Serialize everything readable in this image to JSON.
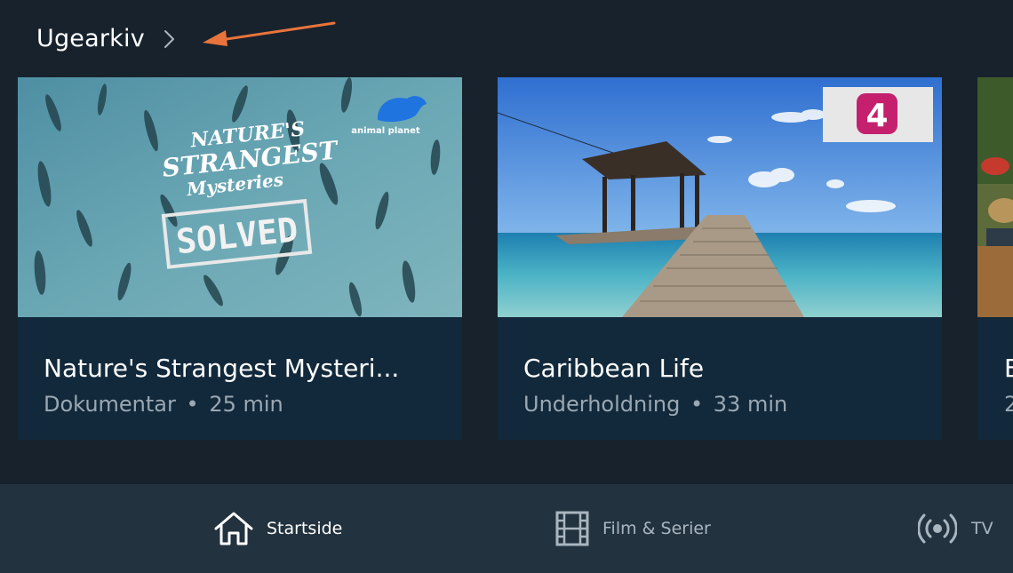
{
  "section": {
    "title": "Ugearkiv"
  },
  "cards": [
    {
      "title": "Nature's Strangest Mysteri...",
      "genre": "Dokumentar",
      "separator": "•",
      "duration": "25 min",
      "art_text": [
        "NATURE'S",
        "STRANGEST",
        "Mysteries",
        "SOLVED"
      ],
      "channel_logo": "animal planet"
    },
    {
      "title": "Caribbean Life",
      "genre": "Underholdning",
      "separator": "•",
      "duration": "33 min",
      "channel_logo": "4"
    },
    {
      "title": "E",
      "meta": "2"
    }
  ],
  "nav": {
    "home_label": "Startside",
    "film_label": "Film & Serier",
    "tv_label": "TV",
    "icons": [
      "home-icon",
      "film-icon",
      "broadcast-icon"
    ]
  },
  "colors": {
    "background": "#17222d",
    "card": "#12293b",
    "nav_bar": "#22323f",
    "annotation_arrow": "#e8743b",
    "meta_text": "#9aa8b3"
  }
}
